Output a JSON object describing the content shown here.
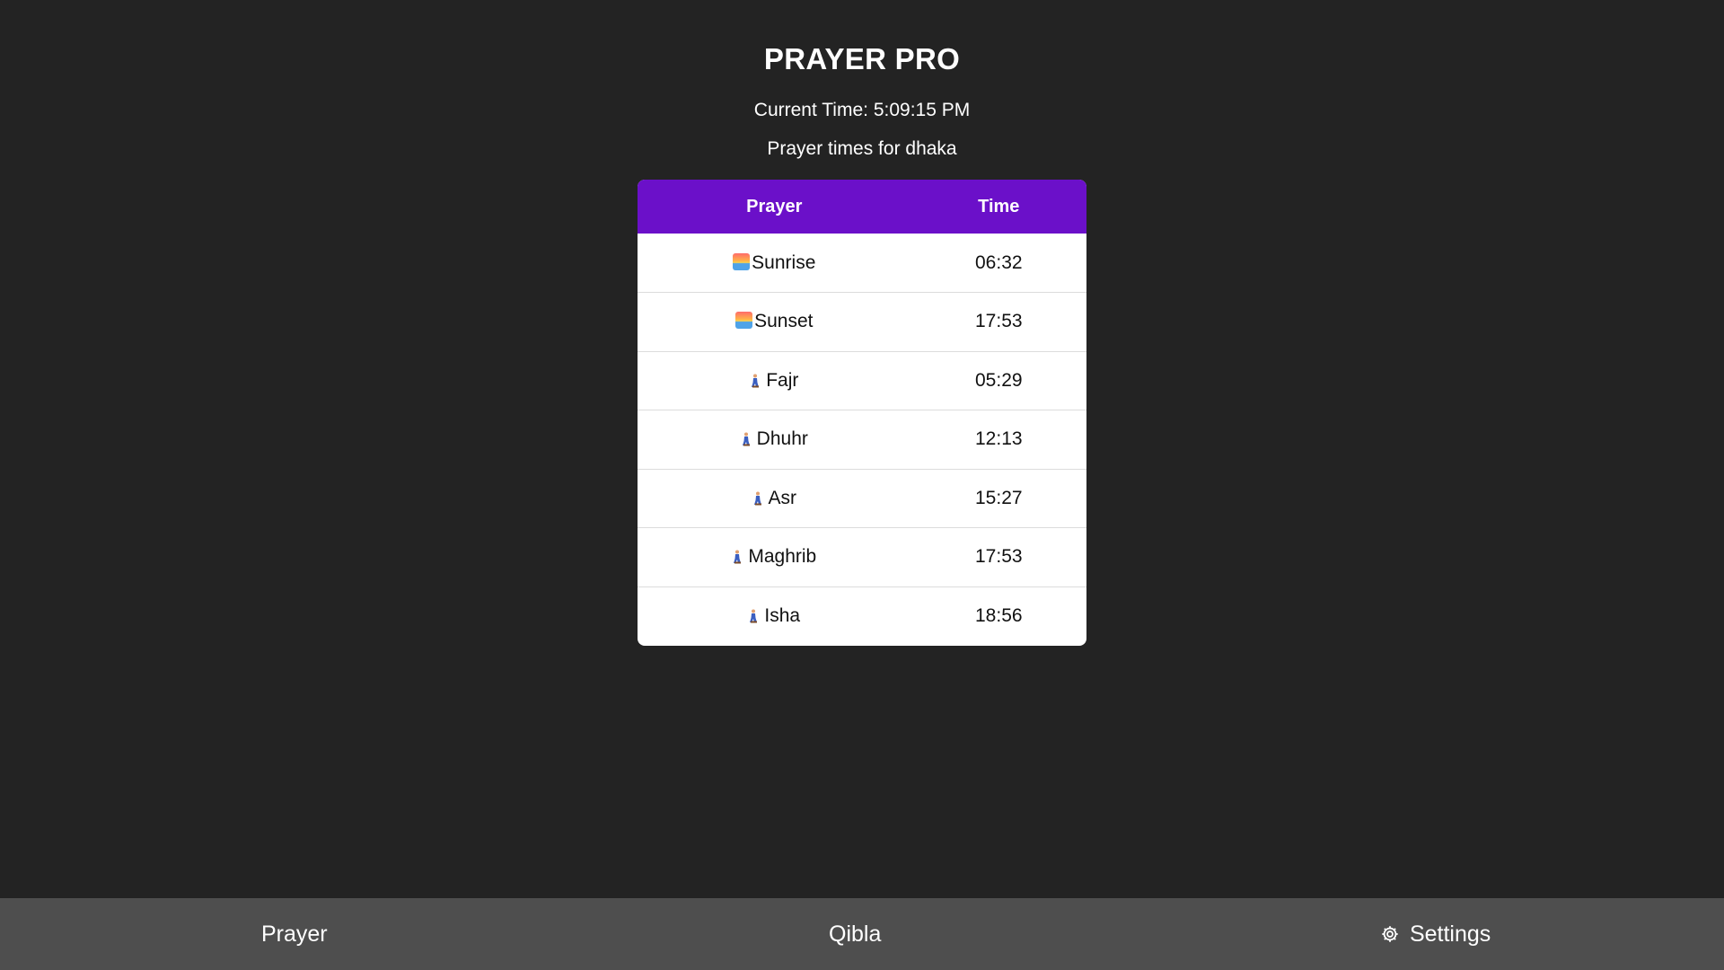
{
  "header": {
    "title": "PRAYER PRO",
    "current_time": "Current Time: 5:09:15 PM",
    "location_line": "Prayer times for dhaka"
  },
  "table": {
    "headers": [
      "Prayer",
      "Time"
    ],
    "rows": [
      {
        "icon": "sunrise-icon",
        "name": "Sunrise",
        "time": "06:32"
      },
      {
        "icon": "sunrise-icon",
        "name": "Sunset",
        "time": "17:53"
      },
      {
        "icon": "kneeling-person-icon",
        "name": "Fajr",
        "time": "05:29"
      },
      {
        "icon": "kneeling-person-icon",
        "name": "Dhuhr",
        "time": "12:13"
      },
      {
        "icon": "kneeling-person-icon",
        "name": "Asr",
        "time": "15:27"
      },
      {
        "icon": "kneeling-person-icon",
        "name": "Maghrib",
        "time": "17:53"
      },
      {
        "icon": "kneeling-person-icon",
        "name": "Isha",
        "time": "18:56"
      }
    ]
  },
  "nav": {
    "prayer_label": "Prayer",
    "qibla_label": "Qibla",
    "settings_label": "Settings",
    "settings_icon": "gear-icon"
  },
  "colors": {
    "background": "#232323",
    "accent": "#6b10c9",
    "nav_background": "#4e4e4e"
  }
}
